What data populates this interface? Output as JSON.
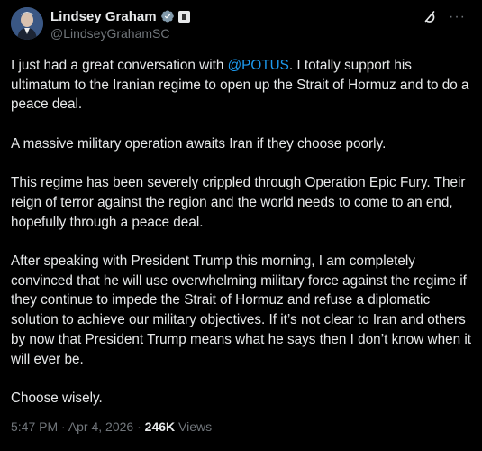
{
  "author": {
    "display_name": "Lindsey Graham",
    "handle": "@LindseyGrahamSC",
    "verified_icon": "verified-badge-icon",
    "affiliate_icon": "government-affiliate-badge-icon",
    "avatar": "avatar-photo"
  },
  "header_actions": {
    "grok_icon": "grok-icon",
    "more_label": "···"
  },
  "tweet": {
    "p1_before": "I just had a great conversation with ",
    "p1_mention": "@POTUS",
    "p1_after": ". I totally support his ultimatum to the Iranian regime to open up the Strait of Hormuz and to do a peace deal.",
    "p2": "A massive military operation awaits Iran if they choose poorly.",
    "p3": "This regime has been severely crippled through Operation Epic Fury. Their reign of terror against the region and the world needs to come to an end, hopefully through a peace deal.",
    "p4": "After speaking with President Trump this morning, I am completely convinced that he will use overwhelming military force against the regime if they continue to impede the Strait of Hormuz and refuse a diplomatic solution to achieve our military objectives. If it’s not clear to Iran and others by now that President Trump means what he says then I don’t know when it will ever be.",
    "p5": "Choose wisely."
  },
  "meta": {
    "time": "5:47 PM",
    "separator1": " · ",
    "date": "Apr 4, 2026",
    "separator2": " · ",
    "views_count": "246K",
    "views_label": " Views"
  },
  "colors": {
    "background": "#000000",
    "text": "#e7e9ea",
    "secondary": "#71767b",
    "link": "#1d9bf0",
    "verified": "#1d9bf0"
  }
}
